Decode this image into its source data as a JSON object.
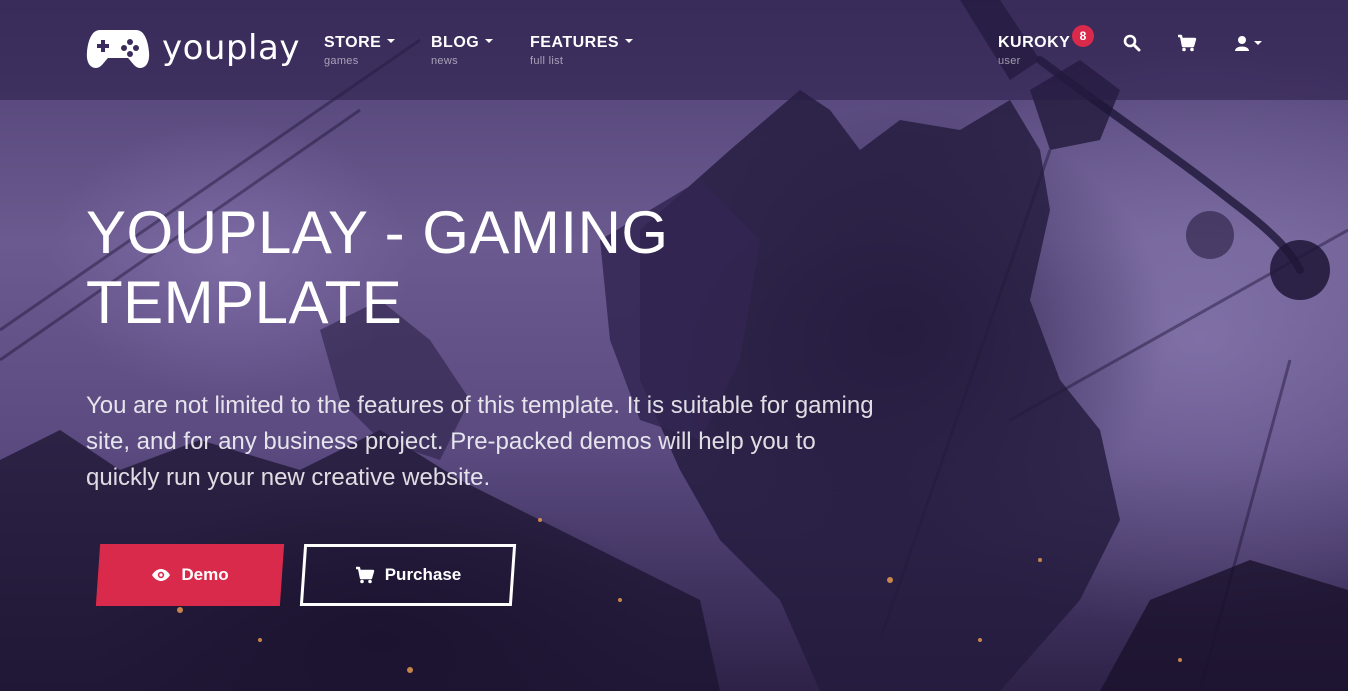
{
  "brand": {
    "name": "youplay"
  },
  "nav": {
    "items": [
      {
        "label": "STORE",
        "sub": "games"
      },
      {
        "label": "BLOG",
        "sub": "news"
      },
      {
        "label": "FEATURES",
        "sub": "full list"
      }
    ],
    "user": {
      "name": "KUROKY",
      "sub": "user",
      "notifications": "8"
    },
    "icons": [
      "search-icon",
      "cart-icon",
      "user-icon"
    ]
  },
  "hero": {
    "title_line1": "YOUPLAY - GAMING",
    "title_line2": "TEMPLATE",
    "text": "You are not limited to the features of this template. It is suitable for gaming site, and for any business project. Pre-packed demos will help you to quickly run your new creative website.",
    "buttons": {
      "demo": "Demo",
      "purchase": "Purchase"
    }
  },
  "colors": {
    "accent": "#d92a4c",
    "navbar": "#281c46",
    "background": "#5a4a80"
  }
}
